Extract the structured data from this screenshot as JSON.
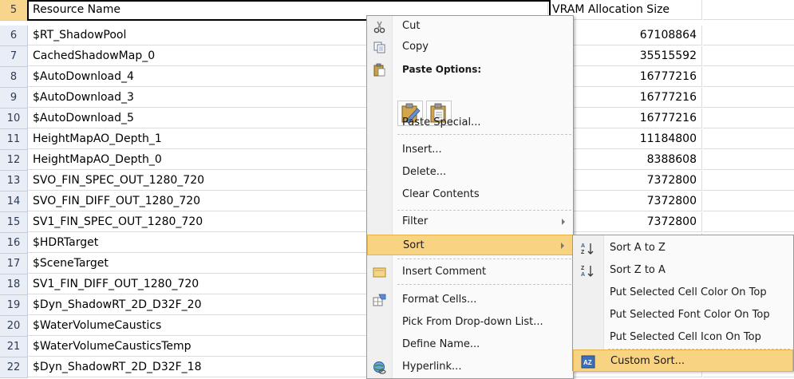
{
  "header": {
    "row_number": "5",
    "col_a": "Resource Name",
    "col_b": "VRAM Allocation Size"
  },
  "rows": [
    {
      "num": "6",
      "name": "$RT_ShadowPool",
      "size": "67108864"
    },
    {
      "num": "7",
      "name": "CachedShadowMap_0",
      "size": "35515592"
    },
    {
      "num": "8",
      "name": "$AutoDownload_4",
      "size": "16777216"
    },
    {
      "num": "9",
      "name": "$AutoDownload_3",
      "size": "16777216"
    },
    {
      "num": "10",
      "name": "$AutoDownload_5",
      "size": "16777216"
    },
    {
      "num": "11",
      "name": "HeightMapAO_Depth_1",
      "size": "11184800"
    },
    {
      "num": "12",
      "name": "HeightMapAO_Depth_0",
      "size": "8388608"
    },
    {
      "num": "13",
      "name": "SVO_FIN_SPEC_OUT_1280_720",
      "size": "7372800"
    },
    {
      "num": "14",
      "name": "SVO_FIN_DIFF_OUT_1280_720",
      "size": "7372800"
    },
    {
      "num": "15",
      "name": "SV1_FIN_SPEC_OUT_1280_720",
      "size": "7372800"
    },
    {
      "num": "16",
      "name": "$HDRTarget",
      "size": ""
    },
    {
      "num": "17",
      "name": "$SceneTarget",
      "size": ""
    },
    {
      "num": "18",
      "name": "SV1_FIN_DIFF_OUT_1280_720",
      "size": ""
    },
    {
      "num": "19",
      "name": "$Dyn_ShadowRT_2D_D32F_20",
      "size": ""
    },
    {
      "num": "20",
      "name": "$WaterVolumeCaustics",
      "size": ""
    },
    {
      "num": "21",
      "name": "$WaterVolumeCausticsTemp",
      "size": ""
    },
    {
      "num": "22",
      "name": "$Dyn_ShadowRT_2D_D32F_18",
      "size": ""
    }
  ],
  "context_menu": {
    "cut": "Cut",
    "copy": "Copy",
    "paste_options": "Paste Options:",
    "paste_special": "Paste Special...",
    "insert": "Insert...",
    "delete": "Delete...",
    "clear_contents": "Clear Contents",
    "filter": "Filter",
    "sort": "Sort",
    "insert_comment": "Insert Comment",
    "format_cells": "Format Cells...",
    "pick_from_list": "Pick From Drop-down List...",
    "define_name": "Define Name...",
    "hyperlink": "Hyperlink..."
  },
  "sort_submenu": {
    "sort_a_z": "Sort A to Z",
    "sort_z_a": "Sort Z to A",
    "cell_color": "Put Selected Cell Color On Top",
    "font_color": "Put Selected Font Color On Top",
    "cell_icon": "Put Selected Cell Icon On Top",
    "custom_sort": "Custom Sort..."
  },
  "colors": {
    "highlight": "#f8d382",
    "row_header_selected": "#f8d58d",
    "row_header": "#e9eef6"
  }
}
